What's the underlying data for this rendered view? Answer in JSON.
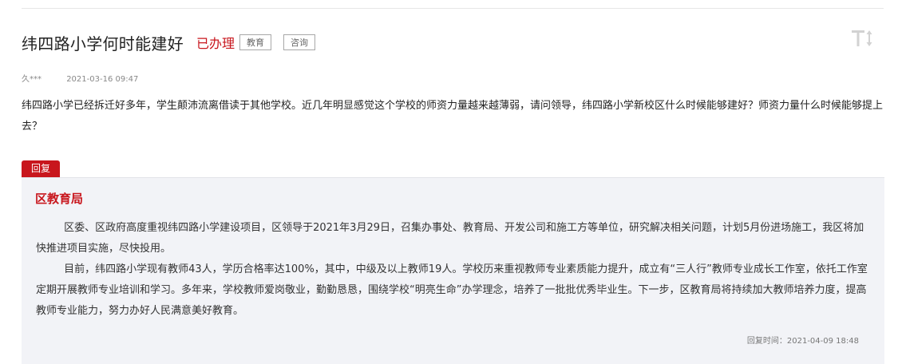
{
  "post": {
    "title": "纬四路小学何时能建好",
    "status": "已办理",
    "tags": [
      "教育",
      "咨询"
    ],
    "author": "久***",
    "date": "2021-03-16 09:47",
    "question": "纬四路小学已经拆迁好多年，学生颠沛流离借读于其他学校。近几年明显感觉这个学校的师资力量越来越薄弱，请问领导，纬四路小学新校区什么时候能够建好？师资力量什么时候能够提上去？"
  },
  "toolbar": {
    "font_toggle_icon": "text-size-icon"
  },
  "reply": {
    "tab_label": "回复",
    "department": "区教育局",
    "paragraphs": [
      "区委、区政府高度重视纬四路小学建设项目，区领导于2021年3月29日，召集办事处、教育局、开发公司和施工方等单位，研究解决相关问题，计划5月份进场施工，我区将加快推进项目实施，尽快投用。",
      "目前，纬四路小学现有教师43人，学历合格率达100%，其中，中级及以上教师19人。学校历来重视教师专业素质能力提升，成立有“三人行”教师专业成长工作室，依托工作室定期开展教师专业培训和学习。多年来，学校教师爱岗敬业，勤勤恳恳，围绕学校“明亮生命”办学理念，培养了一批批优秀毕业生。下一步，区教育局将持续加大教师培养力度，提高教师专业能力，努力办好人民满意美好教育。"
    ],
    "time_label": "回复时间：",
    "time": "2021-04-09 18:48"
  },
  "colors": {
    "accent": "#c8161d",
    "reply_bg": "#f2f3f7"
  }
}
